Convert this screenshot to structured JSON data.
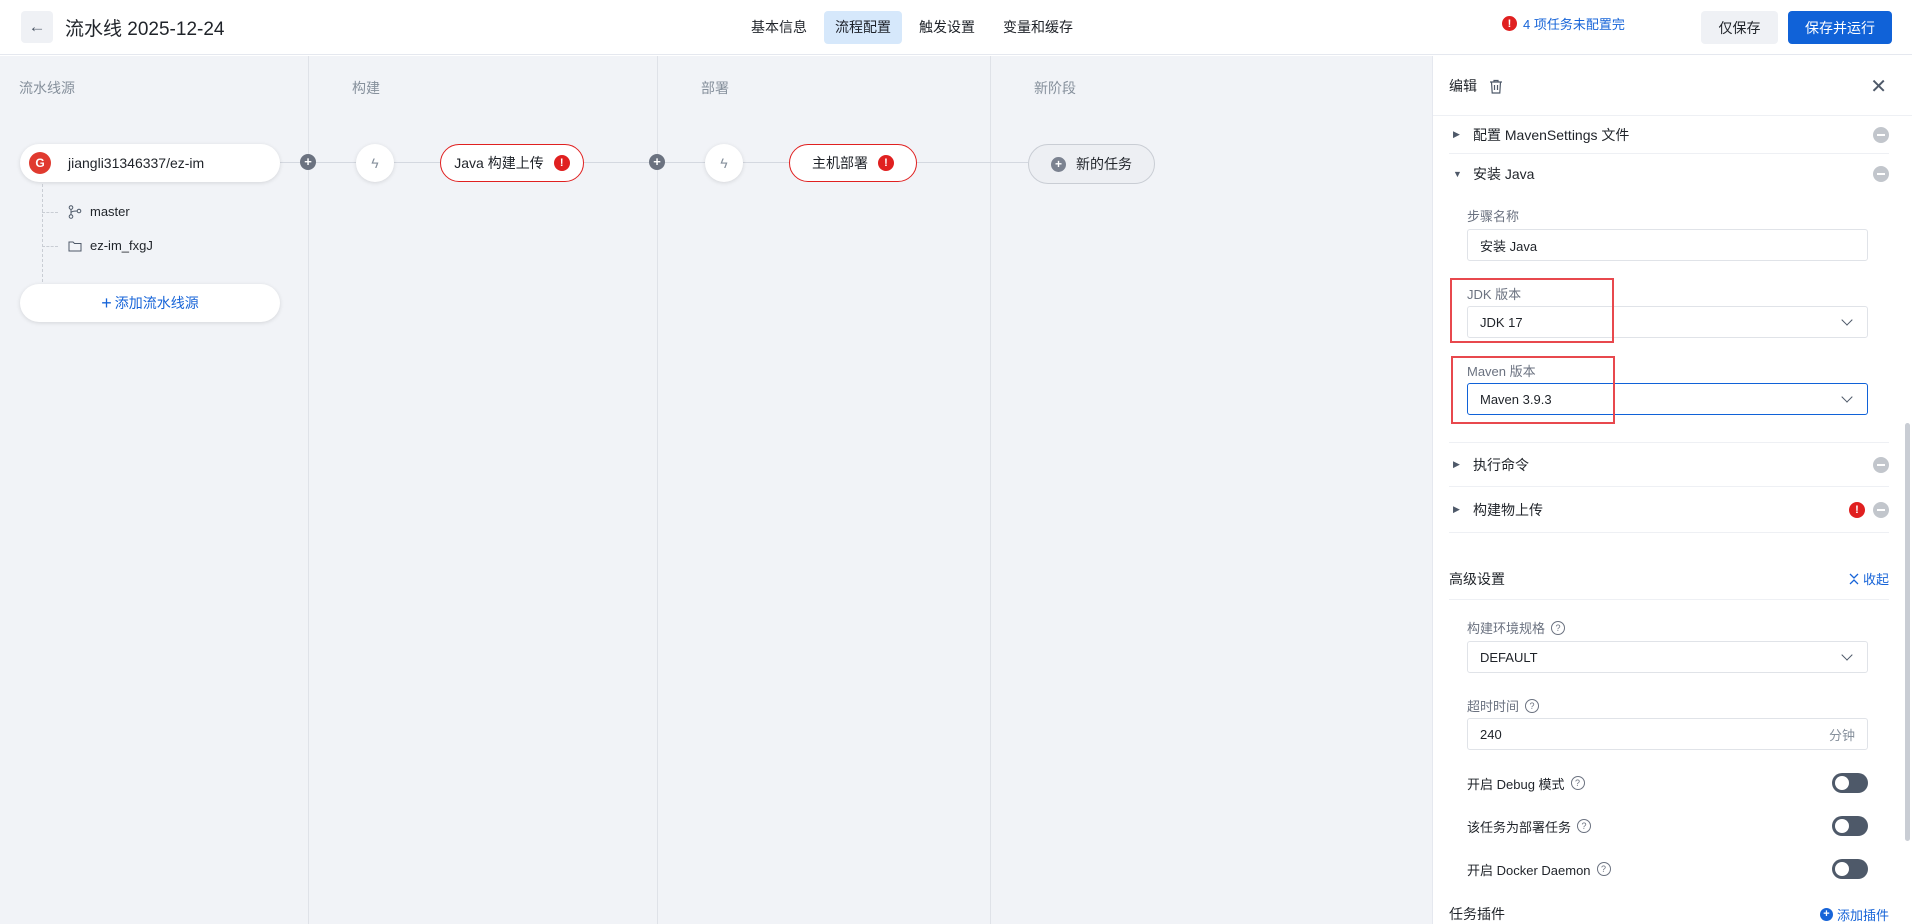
{
  "header": {
    "title": "流水线 2025-12-24",
    "tabs": [
      {
        "label": "基本信息"
      },
      {
        "label": "流程配置"
      },
      {
        "label": "触发设置"
      },
      {
        "label": "变量和缓存"
      }
    ],
    "active_tab": "流程配置",
    "warning": "4 项任务未配置完",
    "save_only": "仅保存",
    "save_and_run": "保存并运行"
  },
  "canvas": {
    "stages": [
      "流水线源",
      "构建",
      "部署",
      "新阶段"
    ],
    "source": {
      "repo": "jiangli31346337/ez-im",
      "branch": "master",
      "folder": "ez-im_fxgJ",
      "logo_letter": "G"
    },
    "add_source": "添加流水线源",
    "tasks": {
      "build": "Java 构建上传",
      "deploy": "主机部署",
      "new_task": "新的任务"
    }
  },
  "panel": {
    "title": "编辑",
    "steps": {
      "maven_settings": "配置 MavenSettings 文件",
      "install_java": "安装 Java",
      "exec_cmd": "执行命令",
      "artifact_upload": "构建物上传"
    },
    "step_name": {
      "label": "步骤名称",
      "value": "安装 Java"
    },
    "jdk": {
      "label": "JDK 版本",
      "value": "JDK 17"
    },
    "maven": {
      "label": "Maven 版本",
      "value": "Maven 3.9.3"
    },
    "advanced": {
      "title": "高级设置",
      "collapse": "收起",
      "env_spec": {
        "label": "构建环境规格",
        "value": "DEFAULT"
      },
      "timeout": {
        "label": "超时时间",
        "value": "240",
        "unit": "分钟"
      },
      "debug": {
        "label": "开启 Debug 模式",
        "on": false
      },
      "deploy_task": {
        "label": "该任务为部署任务",
        "on": false
      },
      "docker": {
        "label": "开启 Docker Daemon",
        "on": false
      }
    },
    "plugins": {
      "title": "任务插件",
      "add": "添加插件"
    }
  },
  "colors": {
    "primary": "#1062d8",
    "error": "#e02020",
    "highlight_box": "#e8484d"
  }
}
